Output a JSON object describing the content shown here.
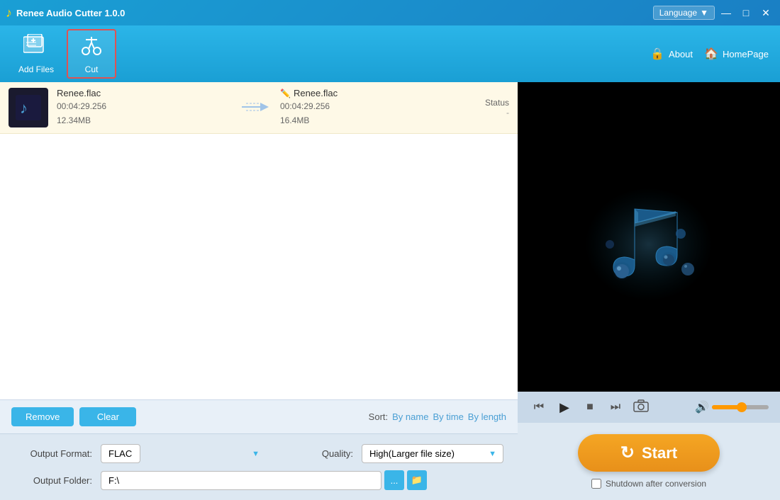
{
  "titleBar": {
    "title": "Renee Audio Cutter 1.0.0",
    "logoIcon": "♪",
    "language": "Language",
    "dropIcon": "▼",
    "minimizeIcon": "—",
    "maximizeIcon": "□",
    "closeIcon": "✕"
  },
  "toolbar": {
    "addFilesLabel": "Add Files",
    "cutLabel": "Cut",
    "aboutLabel": "About",
    "homePageLabel": "HomePage",
    "lockIcon": "🔒",
    "homeIcon": "🏠"
  },
  "fileList": {
    "items": [
      {
        "inputName": "Renee.flac",
        "inputDuration": "00:04:29.256",
        "inputSize": "12.34MB",
        "outputName": "Renee.flac",
        "outputDuration": "00:04:29.256",
        "outputSize": "16.4MB",
        "statusLabel": "Status",
        "statusValue": "-"
      }
    ]
  },
  "bottomControls": {
    "removeLabel": "Remove",
    "clearLabel": "Clear",
    "sortLabel": "Sort:",
    "sortByName": "By name",
    "sortByTime": "By time",
    "sortByLength": "By length"
  },
  "settings": {
    "outputFormatLabel": "Output Format:",
    "outputFormatValue": "FLAC",
    "qualityLabel": "Quality:",
    "qualityValue": "High(Larger file size)",
    "outputFolderLabel": "Output Folder:",
    "outputFolderValue": "F:\\",
    "browseBtnLabel": "...",
    "openFolderLabel": "📁"
  },
  "player": {
    "skipBackIcon": "⏮",
    "playIcon": "▶",
    "stopIcon": "■",
    "skipForwardIcon": "⏭",
    "cameraIcon": "📷",
    "volumeIcon": "🔊",
    "volumePercent": 55
  },
  "rightPanel": {
    "startLabel": "Start",
    "startIcon": "↻",
    "shutdownLabel": "Shutdown after conversion"
  }
}
